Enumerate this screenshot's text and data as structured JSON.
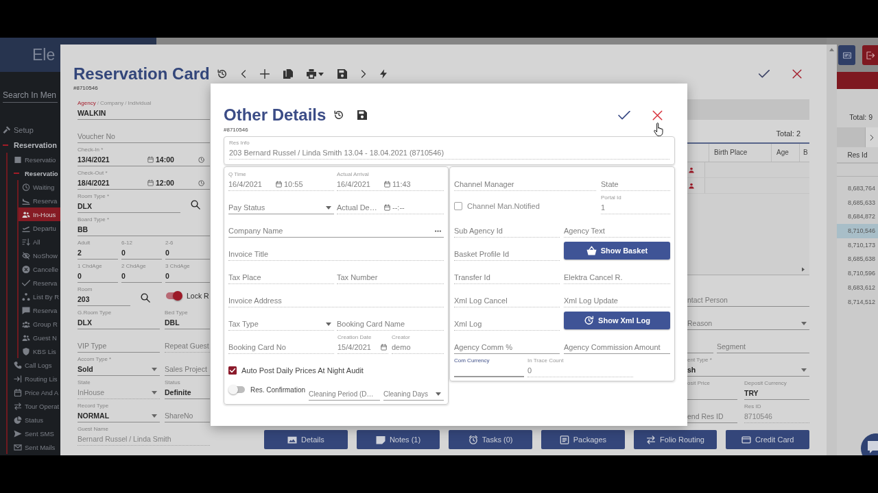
{
  "sidebar": {
    "logo": "Ele",
    "search": {
      "placeholder": "Search In Men"
    },
    "items": [
      {
        "label": "Setup",
        "selected": false
      },
      {
        "label": "Reservation",
        "selected": false,
        "expanded": true,
        "children": [
          {
            "label": "Reservatio",
            "selected": false
          },
          {
            "label": "Reservatio",
            "selected": false,
            "expanded": true,
            "children": [
              {
                "label": "Waiting",
                "selected": false
              },
              {
                "label": "Reserva",
                "selected": false
              },
              {
                "label": "In-Hous",
                "selected": true
              },
              {
                "label": "Departu",
                "selected": false
              },
              {
                "label": "All",
                "selected": false
              },
              {
                "label": "NoShow",
                "selected": false
              },
              {
                "label": "Cancelle",
                "selected": false
              },
              {
                "label": "Reserva",
                "selected": false
              },
              {
                "label": "List By R",
                "selected": false
              },
              {
                "label": "Reserva",
                "selected": false
              },
              {
                "label": "Group R",
                "selected": false
              },
              {
                "label": "Guest N",
                "selected": false
              },
              {
                "label": "KBS Lis",
                "selected": false
              }
            ]
          },
          {
            "label": "Call Logs",
            "selected": false
          },
          {
            "label": "Routing Lis",
            "selected": false
          },
          {
            "label": "Price And A",
            "selected": false
          },
          {
            "label": "Tour Operat",
            "selected": false
          },
          {
            "label": "Status",
            "selected": false
          },
          {
            "label": "Sent SMS",
            "selected": false
          },
          {
            "label": "Sent Mails",
            "selected": false
          }
        ]
      }
    ]
  },
  "card": {
    "title": "Reservation Card",
    "number": "#8710546",
    "form": [
      [
        {
          "kind": "party",
          "options": [
            {
              "label": "Agency",
              "selected": true
            },
            {
              "label": "Company",
              "selected": false
            },
            {
              "label": "Individual",
              "selected": false
            }
          ],
          "separator": "/",
          "value": "WALKIN",
          "disabled": false
        }
      ],
      [
        {
          "kind": "text",
          "placeholder": "Voucher No",
          "disabled": false
        }
      ],
      [
        {
          "kind": "datetime",
          "label": "Check-In *",
          "value": "13/4/2021",
          "time": "14:00",
          "disabled": false
        }
      ],
      [
        {
          "kind": "datetime",
          "label": "Check-Out *",
          "value": "18/4/2021",
          "time": "12:00",
          "disabled": false
        }
      ],
      [
        {
          "kind": "lookup",
          "label": "Room Type *",
          "value": "DLX",
          "disabled": false
        }
      ],
      [
        {
          "kind": "text",
          "label": "Board Type *",
          "value": "BB",
          "disabled": false
        }
      ],
      [
        {
          "kind": "text",
          "label": "Adult",
          "value": "2",
          "disabled": false
        },
        {
          "kind": "text",
          "label": "6-12",
          "value": "0",
          "disabled": false
        },
        {
          "kind": "text",
          "label": "2-6",
          "value": "0",
          "disabled": false
        }
      ],
      [
        {
          "kind": "text",
          "label": "1 ChdAge",
          "value": "0",
          "disabled": false
        },
        {
          "kind": "text",
          "label": "2 ChdAge",
          "value": "0",
          "disabled": false
        },
        {
          "kind": "text",
          "label": "3 ChdAge",
          "value": "0",
          "disabled": false
        }
      ],
      [
        {
          "kind": "lookup",
          "label": "Room",
          "value": "203",
          "disabled": false
        },
        {
          "kind": "toggle",
          "label": "Lock R",
          "on": true
        }
      ],
      [
        {
          "kind": "text",
          "label": "G.Room Type",
          "value": "DLX",
          "disabled": false
        },
        {
          "kind": "text",
          "label": "Bed Type",
          "value": "DBL",
          "disabled": false
        }
      ],
      [
        {
          "kind": "text",
          "placeholder": "VIP Type",
          "disabled": false
        },
        {
          "kind": "text",
          "placeholder": "Repeat Guest",
          "disabled": true
        }
      ],
      [
        {
          "kind": "select",
          "label": "Accom Type *",
          "value": "Sold",
          "disabled": false
        },
        {
          "kind": "text",
          "placeholder": "Sales Project",
          "disabled": false
        }
      ],
      [
        {
          "kind": "select",
          "label": "State",
          "value": "InHouse",
          "disabled": true
        },
        {
          "kind": "text",
          "label": "Status",
          "value": "Definite",
          "disabled": false
        }
      ],
      [
        {
          "kind": "select",
          "label": "Record Type",
          "value": "NORMAL",
          "disabled": false
        },
        {
          "kind": "text",
          "placeholder": "ShareNo",
          "disabled": false
        }
      ],
      [
        {
          "kind": "text",
          "label": "Guest Name",
          "value": "Bernard Russel / Linda Smith",
          "disabled": true
        }
      ]
    ],
    "guest_table": {
      "total": "Total: 2",
      "columns": [
        {
          "label": "Birth Place"
        },
        {
          "label": "Age"
        },
        {
          "label": "B"
        }
      ],
      "rows": [
        {
          "selected": false
        },
        {
          "selected": false
        }
      ]
    },
    "fields": [
      [
        {
          "kind": "text",
          "placeholder": "ntact Person",
          "disabled": false
        }
      ],
      [
        {
          "kind": "select",
          "placeholder": "Reason",
          "disabled": false
        }
      ],
      [
        {
          "kind": "text",
          "disabled": false
        },
        {
          "kind": "text",
          "placeholder": "Segment",
          "disabled": false
        }
      ],
      [
        {
          "kind": "select",
          "label": "ent Type *",
          "value": "sh",
          "disabled": false
        }
      ],
      [
        {
          "kind": "text",
          "label": "osit Price",
          "disabled": false
        },
        {
          "kind": "text",
          "label": "Deposit Currency",
          "value": "TRY",
          "disabled": false
        }
      ],
      [
        {
          "kind": "text",
          "placeholder": "end Res ID",
          "disabled": false
        },
        {
          "kind": "text",
          "label": "Res ID",
          "value": "8710546",
          "disabled": true
        }
      ]
    ],
    "buttons": [
      "Details",
      "Notes (1)",
      "Tasks (0)",
      "Packages",
      "Folio Routing",
      "Credit Card"
    ]
  },
  "results": {
    "total": "Total: 9",
    "column": "Res Id",
    "rows": [
      {
        "value": "8,683,764",
        "selected": false
      },
      {
        "value": "8,685,633",
        "selected": false
      },
      {
        "value": "8,684,872",
        "selected": false
      },
      {
        "value": "8,710,546",
        "selected": true
      },
      {
        "value": "8,710,173",
        "selected": false
      },
      {
        "value": "8,685,638",
        "selected": false
      },
      {
        "value": "8,710,596",
        "selected": false
      },
      {
        "value": "8,683,612",
        "selected": false
      },
      {
        "value": "8,714,512",
        "selected": false
      }
    ]
  },
  "dialog": {
    "title": "Other Details",
    "number": "#8710546",
    "res_info": {
      "kind": "text",
      "label": "Res Info",
      "value": "203 Bernard Russel / Linda Smith 13.04 - 18.04.2021 (8710546)",
      "disabled": true
    },
    "left": [
      [
        {
          "kind": "datetime",
          "label": "Q Time",
          "value": "16/4/2021",
          "time": "10:55",
          "disabled": true
        },
        {
          "kind": "datetime",
          "label": "Actual Arrival",
          "value": "16/4/2021",
          "time": "11:43",
          "disabled": true
        }
      ],
      [
        {
          "kind": "select",
          "placeholder": "Pay Status",
          "disabled": false
        },
        {
          "kind": "datetime",
          "placeholder": "Actual De…",
          "time": "--:--",
          "disabled": true
        }
      ],
      [
        {
          "kind": "picker",
          "placeholder": "Company Name",
          "disabled": false
        }
      ],
      [
        {
          "kind": "text",
          "placeholder": "Invoice Title",
          "disabled": true
        }
      ],
      [
        {
          "kind": "text",
          "placeholder": "Tax Place",
          "disabled": true
        },
        {
          "kind": "text",
          "placeholder": "Tax Number",
          "disabled": true
        }
      ],
      [
        {
          "kind": "text",
          "placeholder": "Invoice Address",
          "disabled": true
        }
      ],
      [
        {
          "kind": "select",
          "placeholder": "Tax Type",
          "disabled": true
        },
        {
          "kind": "text",
          "placeholder": "Booking Card Name",
          "disabled": true
        }
      ],
      [
        {
          "kind": "text",
          "placeholder": "Booking Card No",
          "disabled": true
        },
        {
          "kind": "date",
          "label": "Creation Date",
          "value": "15/4/2021",
          "disabled": true
        },
        {
          "kind": "text",
          "label": "Creator",
          "value": "demo",
          "disabled": true
        }
      ],
      [
        {
          "kind": "checkbox",
          "label": "Auto Post Daily Prices At Night Audit",
          "checked": true
        }
      ],
      [
        {
          "kind": "toggle",
          "label": "Res. Confirmation",
          "on": false
        },
        {
          "kind": "text",
          "placeholder": "Cleaning Period (D…",
          "disabled": false
        },
        {
          "kind": "select",
          "placeholder": "Cleaning Days",
          "disabled": false
        }
      ]
    ],
    "right": [
      [
        {
          "kind": "text",
          "placeholder": "Channel Manager",
          "disabled": true
        },
        {
          "kind": "text",
          "placeholder": "State",
          "disabled": true
        }
      ],
      [
        {
          "kind": "checkbox",
          "label": "Channel Man.Notified",
          "checked": false
        },
        {
          "kind": "text",
          "label": "Portal Id",
          "value": "1",
          "disabled": true
        }
      ],
      [
        {
          "kind": "text",
          "placeholder": "Sub Agency Id",
          "disabled": true
        },
        {
          "kind": "text",
          "placeholder": "Agency Text",
          "disabled": true
        }
      ],
      [
        {
          "kind": "text",
          "placeholder": "Basket Profile Id",
          "disabled": true
        },
        {
          "kind": "button",
          "label": "Show Basket"
        }
      ],
      [
        {
          "kind": "text",
          "placeholder": "Transfer Id",
          "disabled": true
        },
        {
          "kind": "text",
          "placeholder": "Elektra Cancel R.",
          "disabled": true
        }
      ],
      [
        {
          "kind": "text",
          "placeholder": "Xml Log Cancel",
          "disabled": true
        },
        {
          "kind": "text",
          "placeholder": "Xml Log Update",
          "disabled": true
        }
      ],
      [
        {
          "kind": "text",
          "placeholder": "Xml Log",
          "disabled": true
        },
        {
          "kind": "button",
          "label": "Show Xml Log"
        }
      ],
      [
        {
          "kind": "text",
          "placeholder": "Agency Comm %",
          "disabled": false
        },
        {
          "kind": "text",
          "placeholder": "Agency Commission Amount",
          "disabled": false
        }
      ],
      [
        {
          "kind": "text",
          "label": "Com Currency",
          "disabled": false,
          "focused": true
        },
        {
          "kind": "text",
          "label": "In Trace Count",
          "value": "0",
          "disabled": true,
          "focused": false
        }
      ]
    ]
  }
}
